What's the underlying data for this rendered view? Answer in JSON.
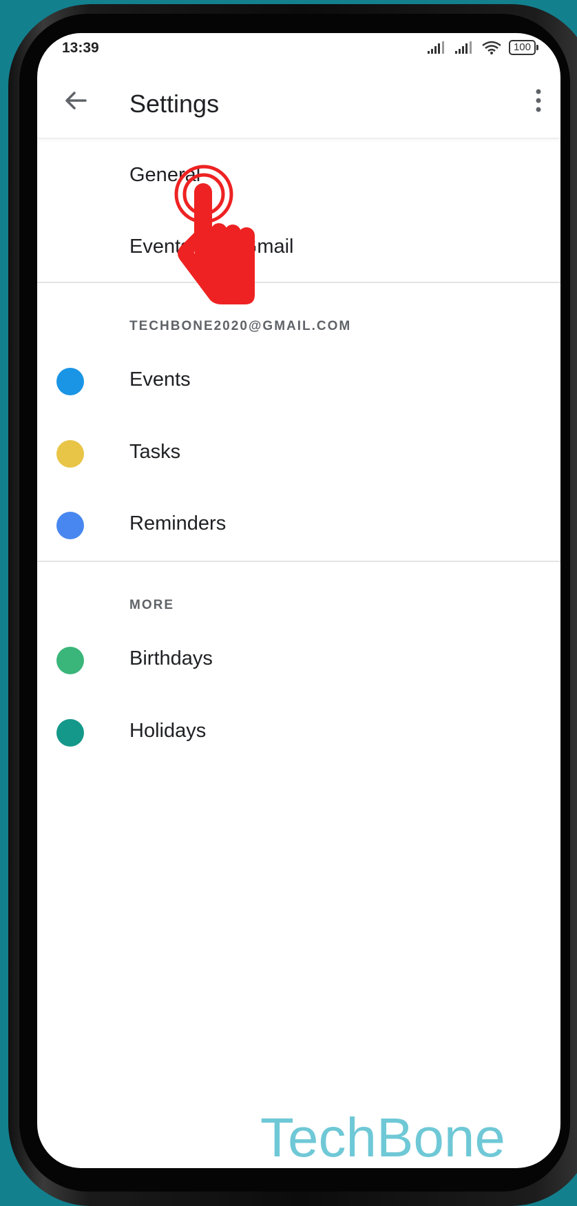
{
  "status_bar": {
    "time": "13:39",
    "battery": "100"
  },
  "header": {
    "title": "Settings"
  },
  "top_items": [
    {
      "label": "General"
    },
    {
      "label": "Events from Gmail"
    }
  ],
  "accounts": [
    {
      "email": "TECHBONE2020@GMAIL.COM",
      "items": [
        {
          "label": "Events",
          "color": "#1a95e6"
        },
        {
          "label": "Tasks",
          "color": "#e8c547"
        },
        {
          "label": "Reminders",
          "color": "#4887f0"
        }
      ]
    }
  ],
  "more": {
    "label": "MORE",
    "items": [
      {
        "label": "Birthdays",
        "color": "#3bb67a"
      },
      {
        "label": "Holidays",
        "color": "#14988a"
      }
    ]
  },
  "watermark": "TechBone",
  "colors": {
    "tap_indicator": "#ee2222",
    "background": "#13808e"
  }
}
